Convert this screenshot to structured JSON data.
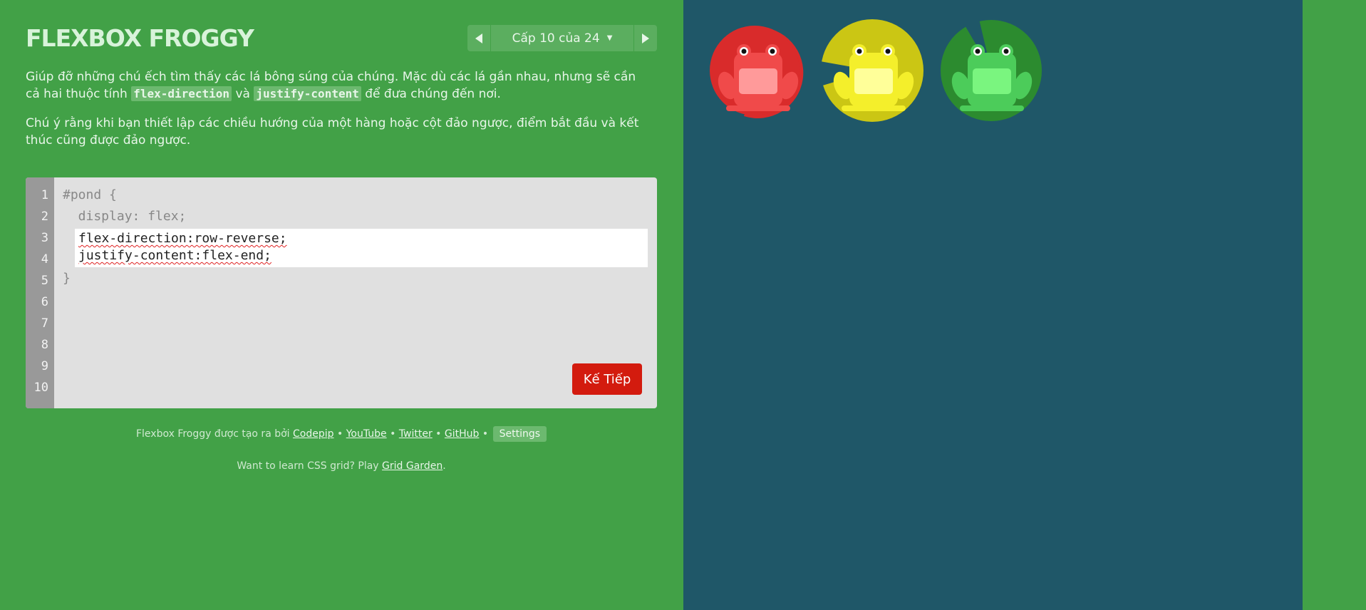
{
  "header": {
    "title": "FLEXBOX FROGGY"
  },
  "level_nav": {
    "label": "Cấp 10 của 24",
    "current": 10,
    "total": 24
  },
  "instructions": {
    "p1_before": "Giúp đỡ những chú ếch tìm thấy các lá bông súng của chúng. Mặc dù các lá gần nhau, nhưng sẽ cần cả hai thuộc tính ",
    "p1_code1": "flex-direction",
    "p1_mid": " và ",
    "p1_code2": "justify-content",
    "p1_after": " để đưa chúng đến nơi.",
    "p2": "Chú ý rằng khi bạn thiết lập các chiều hướng của một hàng hoặc cột đảo ngược, điểm bắt đầu và kết thúc cũng được đảo ngược."
  },
  "editor": {
    "line_numbers": [
      "1",
      "2",
      "3",
      "4",
      "5",
      "6",
      "7",
      "8",
      "9",
      "10"
    ],
    "line1": "#pond {",
    "line2": "  display: flex;",
    "input_line1": "flex-direction:row-reverse;",
    "input_line2": "justify-content:flex-end;",
    "line5": "}",
    "next_button_label": "Kế Tiếp"
  },
  "footer": {
    "credits_prefix": "Flexbox Froggy được tạo ra bởi ",
    "codepip": "Codepip",
    "youtube": "YouTube",
    "twitter": "Twitter",
    "github": "GitHub",
    "sep": " • ",
    "settings": "Settings",
    "grid_prefix": "Want to learn CSS grid? Play ",
    "grid_link": "Grid Garden",
    "grid_suffix": "."
  },
  "board": {
    "lilypads": [
      "red",
      "yellow",
      "green"
    ],
    "frogs": [
      "red",
      "yellow",
      "green"
    ]
  },
  "colors": {
    "page_bg": "#42a147",
    "pond_bg": "#1f5768",
    "button_red": "#d31b0e",
    "frog_red": "#f04a4a",
    "frog_yellow": "#f4ef2b",
    "frog_green": "#4ccc5a"
  }
}
